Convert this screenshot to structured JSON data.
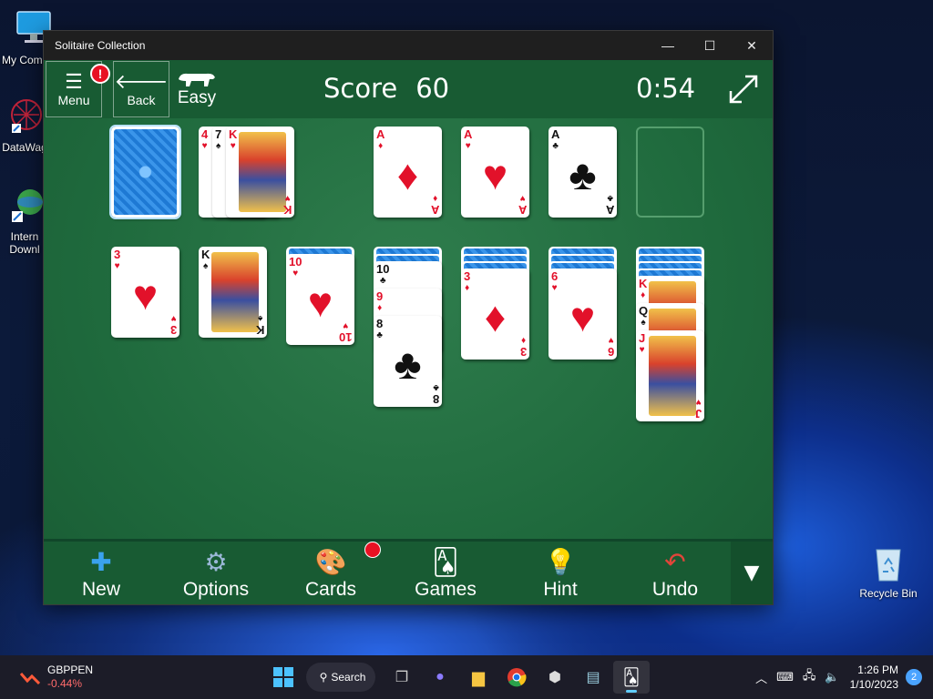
{
  "desktop": {
    "icons": [
      {
        "label": "My Com"
      },
      {
        "label": "DataWag"
      },
      {
        "label": "Intern"
      },
      {
        "label": "Downl"
      },
      {
        "label": "Recycle Bin"
      }
    ]
  },
  "window": {
    "title": "Solitaire Collection",
    "controls": {
      "minimize": "—",
      "maximize": "☐",
      "close": "✕"
    }
  },
  "topbar": {
    "menu_label": "Menu",
    "menu_badge": "!",
    "back_label": "Back",
    "difficulty": "Easy",
    "score_label": "Score",
    "score_value": "60",
    "timer": "0:54"
  },
  "stock": {
    "cards_remaining_visible": true
  },
  "waste": [
    {
      "rank": "4",
      "suit": "♥",
      "color": "red"
    },
    {
      "rank": "7",
      "suit": "♠",
      "color": "black"
    },
    {
      "rank": "K",
      "suit": "♥",
      "color": "red"
    }
  ],
  "foundations": [
    {
      "rank": "A",
      "suit": "♦",
      "color": "red"
    },
    {
      "rank": "A",
      "suit": "♥",
      "color": "red"
    },
    {
      "rank": "A",
      "suit": "♣",
      "color": "black"
    },
    {
      "rank": "",
      "suit": "",
      "color": "empty"
    }
  ],
  "tableau": [
    {
      "hidden": 0,
      "cards": [
        {
          "rank": "3",
          "suit": "♥",
          "color": "red"
        }
      ]
    },
    {
      "hidden": 0,
      "cards": [
        {
          "rank": "K",
          "suit": "♠",
          "color": "black"
        }
      ]
    },
    {
      "hidden": 1,
      "cards": [
        {
          "rank": "10",
          "suit": "♥",
          "color": "red"
        }
      ]
    },
    {
      "hidden": 2,
      "cards": [
        {
          "rank": "10",
          "suit": "♣",
          "color": "black"
        },
        {
          "rank": "9",
          "suit": "♦",
          "color": "red"
        },
        {
          "rank": "8",
          "suit": "♣",
          "color": "black"
        }
      ]
    },
    {
      "hidden": 3,
      "cards": [
        {
          "rank": "3",
          "suit": "♦",
          "color": "red"
        }
      ]
    },
    {
      "hidden": 3,
      "cards": [
        {
          "rank": "6",
          "suit": "♥",
          "color": "red"
        }
      ]
    },
    {
      "hidden": 4,
      "cards": [
        {
          "rank": "K",
          "suit": "♦",
          "color": "red"
        },
        {
          "rank": "Q",
          "suit": "♠",
          "color": "black"
        },
        {
          "rank": "J",
          "suit": "♥",
          "color": "red"
        }
      ]
    }
  ],
  "bottombar": {
    "new": "New",
    "options": "Options",
    "cards": "Cards",
    "games": "Games",
    "hint": "Hint",
    "undo": "Undo"
  },
  "taskbar": {
    "ticker_symbol": "GBPPEN",
    "ticker_change": "-0.44%",
    "search_label": "Search",
    "time": "1:26 PM",
    "date": "1/10/2023",
    "notification_count": "2"
  },
  "colors": {
    "felt": "#1f6a3d",
    "bar": "#185b33",
    "red_suit": "#e2112a",
    "card_back": "#1e79d4"
  }
}
